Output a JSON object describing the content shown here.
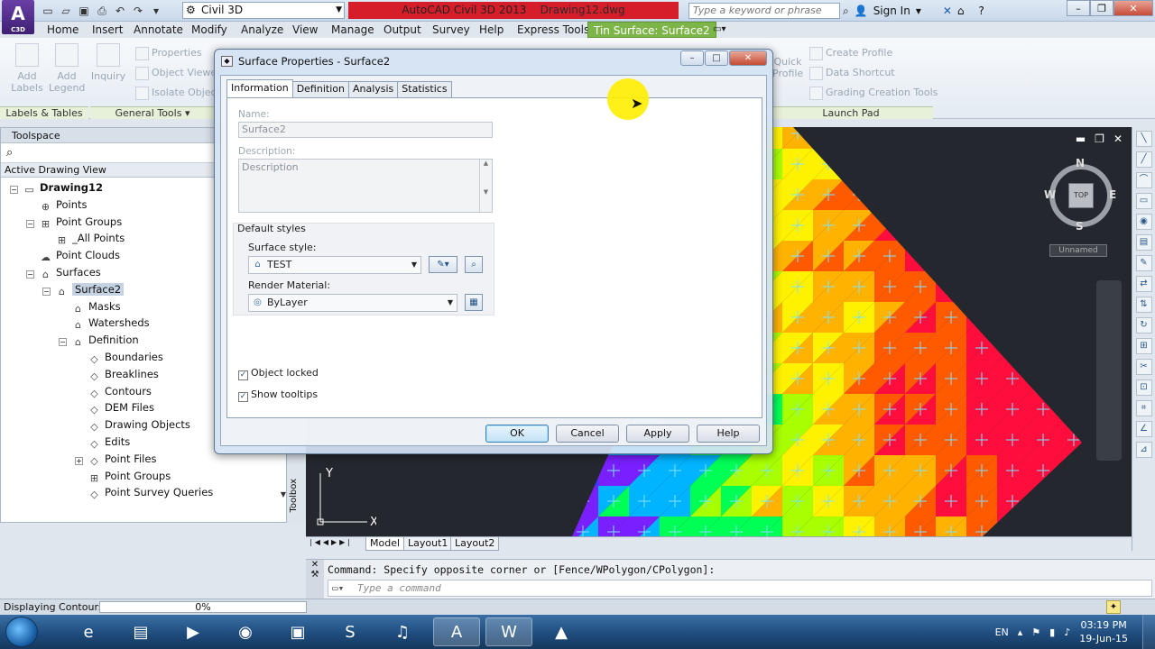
{
  "app": {
    "logo": "A",
    "logo_sub": "C3D",
    "workspace": "Civil 3D",
    "title": "AutoCAD Civil 3D 2013",
    "file": "Drawing12.dwg",
    "search_placeholder": "Type a keyword or phrase",
    "sign_in": "Sign In"
  },
  "ribbon_tabs": [
    "Home",
    "Insert",
    "Annotate",
    "Modify",
    "Analyze",
    "View",
    "Manage",
    "Output",
    "Survey",
    "Help",
    "Express Tools",
    "Tin Surface: Surface2"
  ],
  "ribbon": {
    "add_labels": "Add Labels",
    "add_legend": "Add Legend",
    "inquiry": "Inquiry",
    "properties": "Properties",
    "object_viewer": "Object Viewer",
    "isolate_objects": "Isolate Objects",
    "create_profile": "Create Profile",
    "data_shortcut": "Data Shortcut",
    "grading_creation_tools": "Grading Creation Tools",
    "quick_profile": "Quick Profile",
    "panel_labels_tables": "Labels & Tables",
    "panel_general_tools": "General Tools",
    "panel_launch_pad": "Launch Pad"
  },
  "toolspace": {
    "title": "Toolspace",
    "view": "Active Drawing View",
    "side_label": "Toolbox",
    "tree": [
      {
        "label": "Drawing12",
        "level": 0,
        "toggle": "−",
        "icon": "drawing-icon",
        "bold": true
      },
      {
        "label": "Points",
        "level": 1,
        "toggle": "",
        "icon": "points-icon"
      },
      {
        "label": "Point Groups",
        "level": 1,
        "toggle": "−",
        "icon": "point-groups-icon"
      },
      {
        "label": "_All Points",
        "level": 2,
        "toggle": "",
        "icon": "point-group-icon"
      },
      {
        "label": "Point Clouds",
        "level": 1,
        "toggle": "",
        "icon": "point-clouds-icon"
      },
      {
        "label": "Surfaces",
        "level": 1,
        "toggle": "−",
        "icon": "surfaces-icon"
      },
      {
        "label": "Surface2",
        "level": 2,
        "toggle": "−",
        "icon": "surface-icon",
        "selected": true
      },
      {
        "label": "Masks",
        "level": 3,
        "toggle": "",
        "icon": "masks-icon"
      },
      {
        "label": "Watersheds",
        "level": 3,
        "toggle": "",
        "icon": "watersheds-icon"
      },
      {
        "label": "Definition",
        "level": 3,
        "toggle": "−",
        "icon": "definition-icon"
      },
      {
        "label": "Boundaries",
        "level": 4,
        "toggle": "",
        "icon": "boundaries-icon"
      },
      {
        "label": "Breaklines",
        "level": 4,
        "toggle": "",
        "icon": "breaklines-icon"
      },
      {
        "label": "Contours",
        "level": 4,
        "toggle": "",
        "icon": "contours-icon"
      },
      {
        "label": "DEM Files",
        "level": 4,
        "toggle": "",
        "icon": "dem-files-icon"
      },
      {
        "label": "Drawing Objects",
        "level": 4,
        "toggle": "",
        "icon": "drawing-objects-icon"
      },
      {
        "label": "Edits",
        "level": 4,
        "toggle": "",
        "icon": "edits-icon"
      },
      {
        "label": "Point Files",
        "level": 4,
        "toggle": "+",
        "icon": "point-files-icon"
      },
      {
        "label": "Point Groups",
        "level": 4,
        "toggle": "",
        "icon": "point-groups-icon"
      },
      {
        "label": "Point Survey Queries",
        "level": 4,
        "toggle": "",
        "icon": "point-survey-queries-icon"
      }
    ]
  },
  "viewport": {
    "compass_n": "N",
    "compass_s": "S",
    "compass_e": "E",
    "compass_w": "W",
    "viewcube_face": "TOP",
    "wcs": "Unnamed",
    "ucs_x": "X",
    "ucs_y": "Y"
  },
  "layout_tabs": [
    "Model",
    "Layout1",
    "Layout2"
  ],
  "command": {
    "history": "Command: Specify opposite corner or [Fence/WPolygon/CPolygon]:",
    "placeholder": "Type a command"
  },
  "status": {
    "message": "Displaying Contours...",
    "progress_text": "0%",
    "progress": 0
  },
  "dialog": {
    "title": "Surface Properties - Surface2",
    "tabs": [
      "Information",
      "Definition",
      "Analysis",
      "Statistics"
    ],
    "name_label": "Name:",
    "name_value": "Surface2",
    "description_label": "Description:",
    "description_value": "Description",
    "default_styles": "Default styles",
    "surface_style_label": "Surface style:",
    "surface_style_value": "TEST",
    "render_material_label": "Render Material:",
    "render_material_value": "ByLayer",
    "object_locked": "Object locked",
    "show_tooltips": "Show tooltips",
    "ok": "OK",
    "cancel": "Cancel",
    "apply": "Apply",
    "help": "Help"
  },
  "taskbar": {
    "lang": "EN",
    "time": "03:19 PM",
    "date": "19-Jun-15"
  },
  "colors": {
    "context_tab": "#7db548",
    "title_band": "#d61d2a",
    "drawing_bg": "#24282e"
  }
}
